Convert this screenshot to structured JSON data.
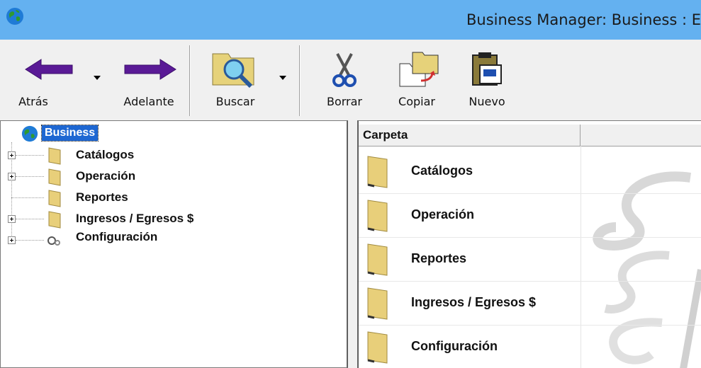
{
  "window": {
    "title": "Business Manager: Business : E"
  },
  "toolbar": {
    "back_label": "Atrás",
    "forward_label": "Adelante",
    "search_label": "Buscar",
    "delete_label": "Borrar",
    "copy_label": "Copiar",
    "new_label": "Nuevo"
  },
  "tree": {
    "root_label": "Business",
    "items": [
      {
        "label": "Catálogos",
        "expandable": true,
        "icon": "folder-icon"
      },
      {
        "label": "Operación",
        "expandable": true,
        "icon": "folder-icon"
      },
      {
        "label": "Reportes",
        "expandable": false,
        "icon": "folder-icon"
      },
      {
        "label": "Ingresos / Egresos $",
        "expandable": true,
        "icon": "folder-icon"
      },
      {
        "label": "Configuración",
        "expandable": true,
        "icon": "gears-icon"
      }
    ]
  },
  "listview": {
    "columns": [
      "Carpeta",
      ""
    ],
    "rows": [
      {
        "label": "Catálogos"
      },
      {
        "label": "Operación"
      },
      {
        "label": "Reportes"
      },
      {
        "label": "Ingresos / Egresos $"
      },
      {
        "label": "Configuración"
      }
    ]
  },
  "colors": {
    "titlebar": "#64b1f0",
    "selection": "#1e67d2",
    "arrow": "#5a1a96",
    "folder": "#e8cf7a"
  }
}
